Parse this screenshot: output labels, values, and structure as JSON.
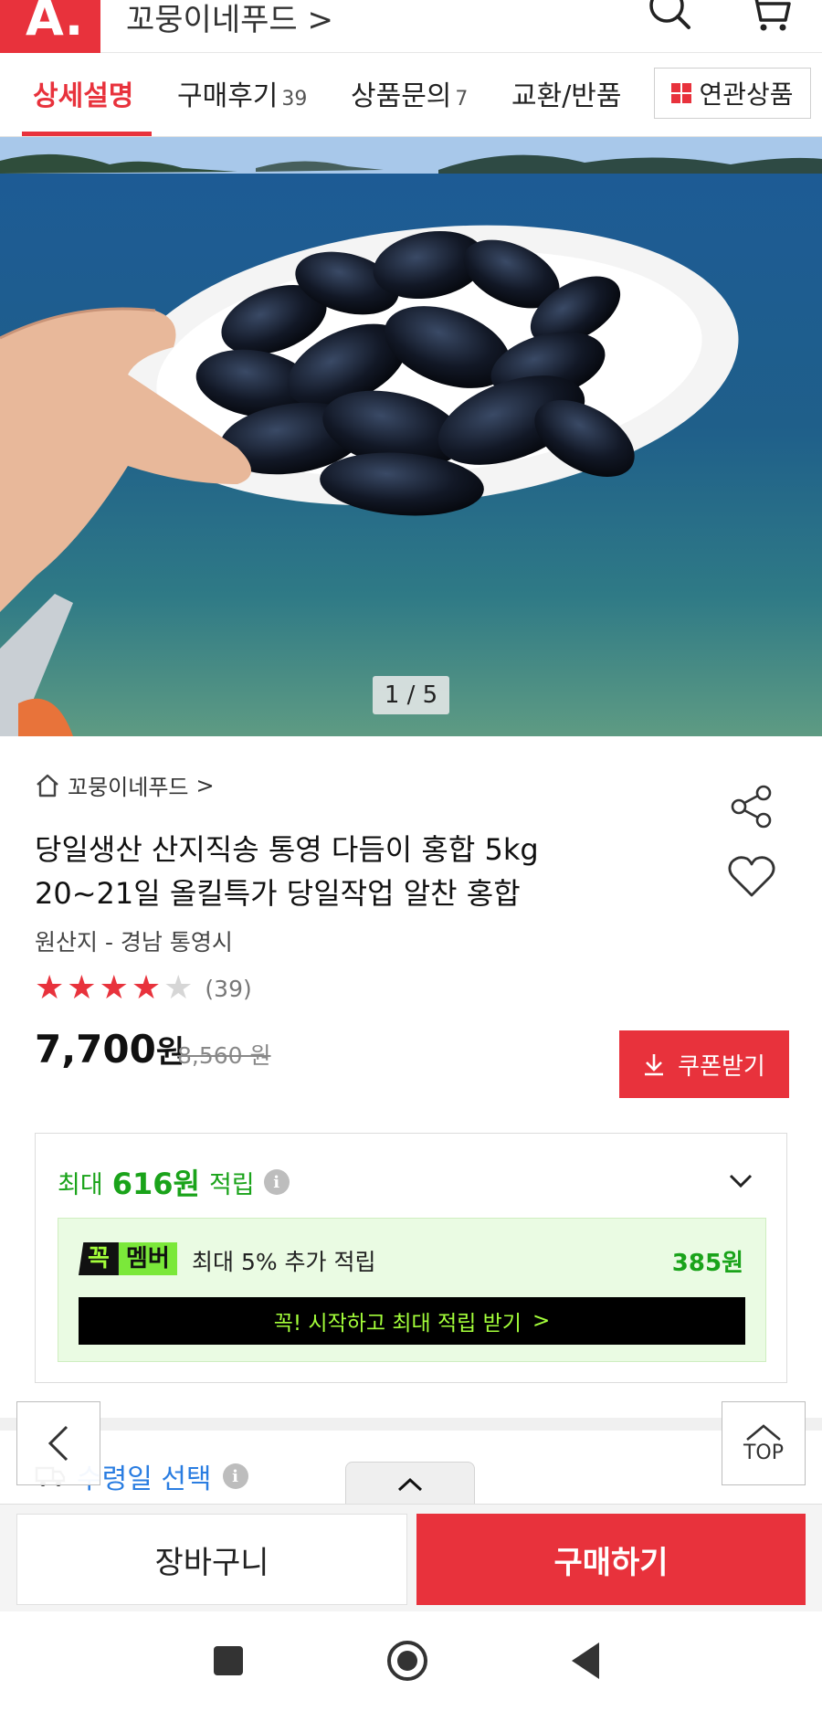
{
  "header": {
    "logo_text": "A.",
    "shop_link": "꼬뭉이네푸드 >",
    "icons": [
      "search-icon",
      "cart-icon"
    ]
  },
  "tabs": [
    {
      "label": "상세설명",
      "count": ""
    },
    {
      "label": "구매후기",
      "count": "39"
    },
    {
      "label": "상품문의",
      "count": "7"
    },
    {
      "label": "교환/반품",
      "count": ""
    }
  ],
  "related_button": "연관상품",
  "image_counter": "1 / 5",
  "product": {
    "shop_name": "꼬뭉이네푸드",
    "shop_chevron": ">",
    "title": "당일생산 산지직송 통영 다듬이 홍합 5kg 20~21일 올킬특가 당일작업 알찬 홍합",
    "origin": "원산지 - 경남 통영시",
    "rating": 4,
    "rating_max": 5,
    "review_count": "(39)",
    "price_number": "7,700",
    "price_unit": "원",
    "original_price": "8,560 원",
    "coupon_label": "쿠폰받기"
  },
  "points": {
    "prefix": "최대",
    "amount": "616원",
    "suffix": "적립",
    "member_badge_dark": "꼭",
    "member_badge_green": "멤버",
    "member_text": "최대 5% 추가 적립",
    "member_amount": "385원",
    "member_cta": "꼭! 시작하고 최대 적립 받기",
    "member_cta_chevron": ">"
  },
  "receive_date_label": "수령일 선택",
  "floating": {
    "top_label": "TOP"
  },
  "bottom_bar": {
    "cart_label": "장바구니",
    "buy_label": "구매하기"
  },
  "colors": {
    "brand_red": "#e8323c",
    "point_green": "#1aa31a",
    "member_bg": "#eafbe3",
    "link_blue": "#2a7de1"
  }
}
